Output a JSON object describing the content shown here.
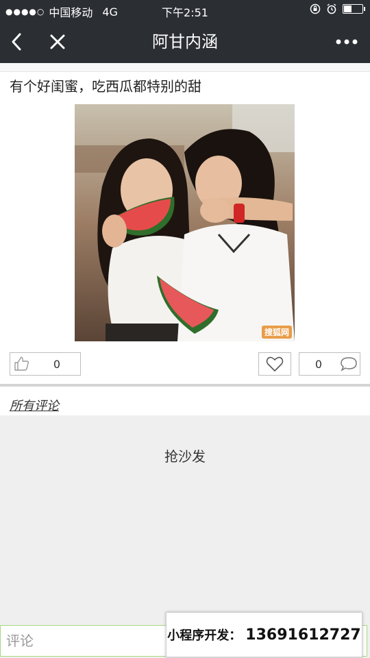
{
  "status": {
    "carrier": "中国移动",
    "network": "4G",
    "time": "下午2:51"
  },
  "nav": {
    "title": "阿甘内涵"
  },
  "post": {
    "text": "有个好闺蜜，吃西瓜都特别的甜",
    "watermark": "搜狐网",
    "likes": "0",
    "comments": "0"
  },
  "comments": {
    "header": "所有评论",
    "empty_text": "抢沙发"
  },
  "input": {
    "placeholder": "评论"
  },
  "promo": {
    "label": "小程序开发：",
    "phone": "13691612727"
  },
  "colors": {
    "navbar": "#2b2e33",
    "background": "#efefef",
    "input_border": "#a8d880"
  }
}
